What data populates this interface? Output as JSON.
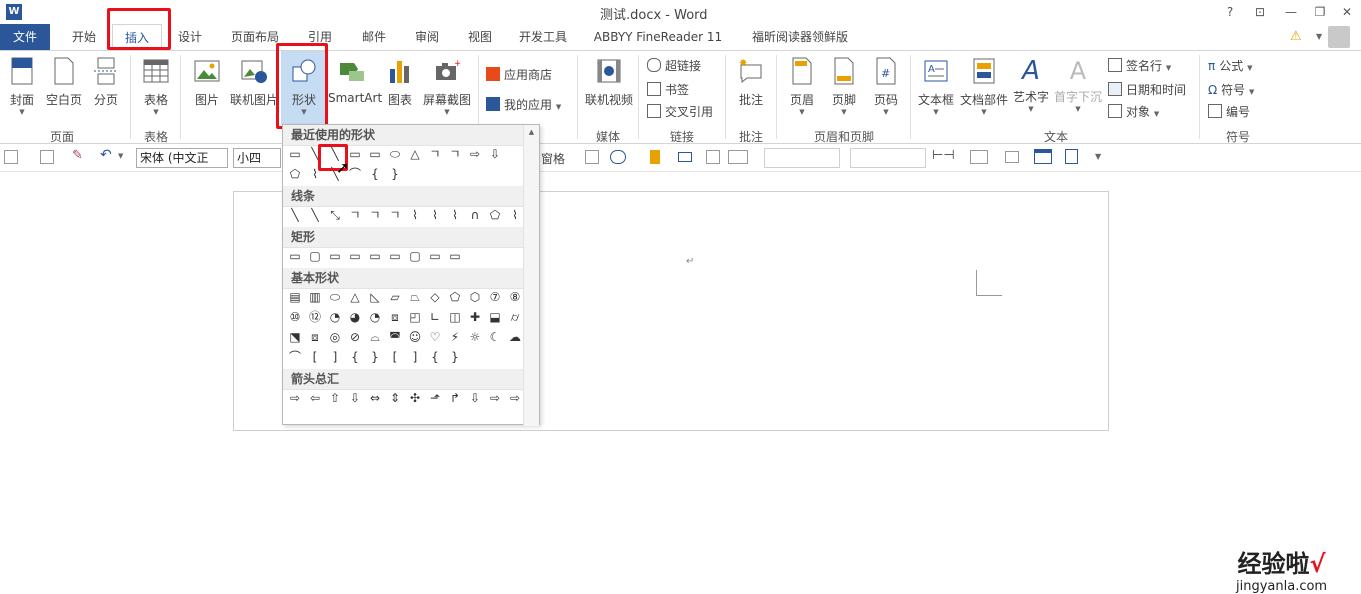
{
  "window": {
    "title": "测试.docx - Word",
    "help": "?",
    "ribbon_display": "⊡",
    "minimize": "—",
    "restore": "❐",
    "close": "✕",
    "user": "👤"
  },
  "tabs": [
    "文件",
    "开始",
    "插入",
    "设计",
    "页面布局",
    "引用",
    "邮件",
    "审阅",
    "视图",
    "开发工具",
    "ABBYY FineReader 11",
    "福昕阅读器领鲜版"
  ],
  "ribbon": {
    "cover": "封面",
    "blank": "空白页",
    "pagebreak": "分页",
    "g_pages": "页面",
    "table": "表格",
    "g_table": "表格",
    "picture": "图片",
    "online_picture": "联机图片",
    "shapes": "形状",
    "smartart": "SmartArt",
    "chart": "图表",
    "screenshot": "屏幕截图",
    "app_store": "应用商店",
    "my_apps": "我的应用",
    "online_video": "联机视频",
    "g_media": "媒体",
    "hyperlink": "超链接",
    "bookmark": "书签",
    "crossref": "交叉引用",
    "g_links": "链接",
    "comment": "批注",
    "g_comments": "批注",
    "header": "页眉",
    "footer": "页脚",
    "page_number": "页码",
    "g_header_footer": "页眉和页脚",
    "textbox": "文本框",
    "quickparts": "文档部件",
    "wordart": "艺术字",
    "dropcap": "首字下沉",
    "signature": "签名行",
    "datetime": "日期和时间",
    "object": "对象",
    "g_text": "文本",
    "equation": "公式",
    "symbol": "符号",
    "numbering": "编号",
    "g_symbols": "符号"
  },
  "qat": {
    "font": "宋体 (中文正",
    "size": "小四",
    "pane": "窗格"
  },
  "shapes_menu": {
    "sections": [
      "最近使用的形状",
      "线条",
      "矩形",
      "基本形状",
      "箭头总汇"
    ],
    "recent_row1": [
      "▭",
      "╲",
      "╲",
      "▭",
      "▭",
      "⬭",
      "△",
      "ㄱ",
      "ㄱ",
      "⇨",
      "⇩"
    ],
    "recent_row2": [
      "⬠",
      "⌇",
      "╲",
      "⌒",
      "{",
      "}"
    ],
    "lines": [
      "╲",
      "╲",
      "⤡",
      "ㄱ",
      "ㄱ",
      "ㄱ",
      "⌇",
      "⌇",
      "⌇",
      "∩",
      "⬠",
      "⌇"
    ],
    "rects": [
      "▭",
      "▢",
      "▭",
      "▭",
      "▭",
      "▭",
      "▢",
      "▭",
      "▭"
    ],
    "basic1": [
      "▤",
      "▥",
      "⬭",
      "△",
      "◺",
      "▱",
      "⏢",
      "◇",
      "⬠",
      "⬡",
      "⑦",
      "⑧"
    ],
    "basic2": [
      "⑩",
      "⑫",
      "◔",
      "◕",
      "◔",
      "⧈",
      "◰",
      "∟",
      "◫",
      "✚",
      "⬓",
      "⌭"
    ],
    "basic3": [
      "⬔",
      "⧈",
      "◎",
      "⊘",
      "⌓",
      "◚",
      "☺",
      "♡",
      "⚡",
      "☼",
      "☾",
      "☁"
    ],
    "basic4": [
      "⌒",
      "[",
      "]",
      "{",
      "}",
      "[",
      "]",
      "{",
      "}"
    ],
    "arrows": [
      "⇨",
      "⇦",
      "⇧",
      "⇩",
      "⇔",
      "⇕",
      "✣",
      "⬏",
      "↱",
      "⇩",
      "⇨",
      "⇨",
      "⇨"
    ]
  },
  "document": {
    "para_mark": "↵"
  },
  "watermark": {
    "main": "经验啦",
    "check": "√",
    "url": "jingyanla.com"
  }
}
